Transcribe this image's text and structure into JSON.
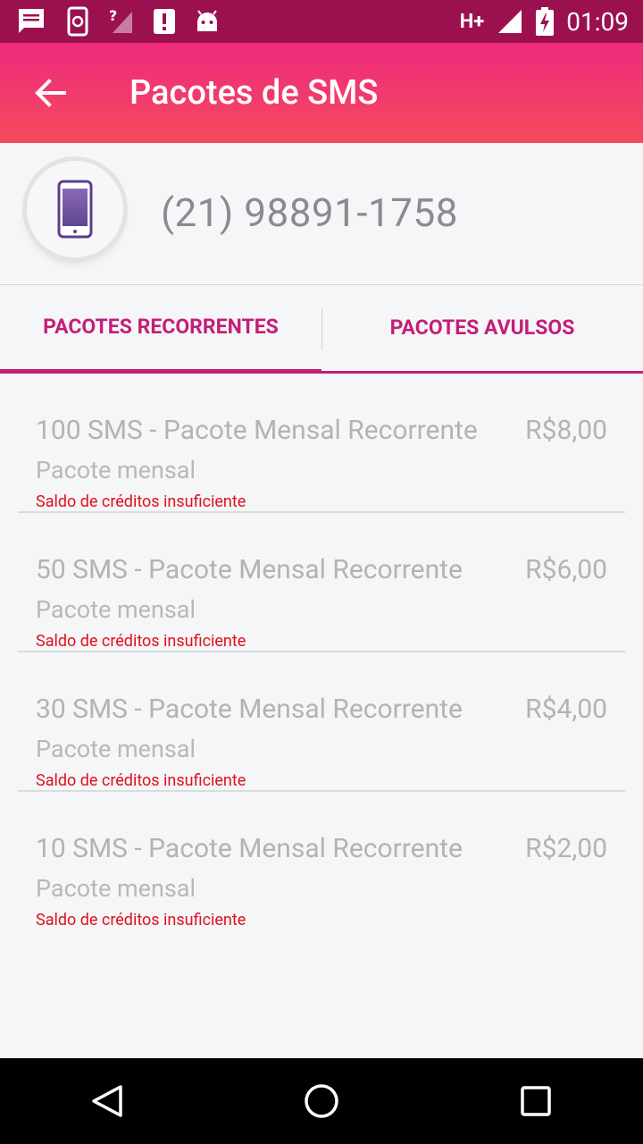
{
  "status_bar": {
    "network_type": "H+",
    "time": "01:09",
    "icons": [
      "message-icon",
      "phone-sync-icon",
      "no-signal-icon",
      "alert-icon",
      "android-icon",
      "signal-icon",
      "battery-charging-icon"
    ]
  },
  "app_bar": {
    "title": "Pacotes de SMS",
    "back_icon": "arrow-left-icon"
  },
  "phone_header": {
    "number": "(21) 98891-1758",
    "avatar_icon": "smartphone-icon"
  },
  "tabs": [
    {
      "label": "PACOTES RECORRENTES",
      "active": true
    },
    {
      "label": "PACOTES AVULSOS",
      "active": false
    }
  ],
  "packages": [
    {
      "title": "100 SMS - Pacote Mensal Recorrente",
      "price": "R$8,00",
      "subtitle": "Pacote mensal",
      "warning": "Saldo de créditos insuficiente"
    },
    {
      "title": "50 SMS - Pacote Mensal Recorrente",
      "price": "R$6,00",
      "subtitle": "Pacote mensal",
      "warning": "Saldo de créditos insuficiente"
    },
    {
      "title": "30 SMS - Pacote Mensal Recorrente",
      "price": "R$4,00",
      "subtitle": "Pacote mensal",
      "warning": "Saldo de créditos insuficiente"
    },
    {
      "title": "10 SMS - Pacote Mensal Recorrente",
      "price": "R$2,00",
      "subtitle": "Pacote mensal",
      "warning": "Saldo de créditos insuficiente"
    }
  ],
  "nav_bar": {
    "icons": [
      "back-triangle-icon",
      "home-circle-icon",
      "recents-square-icon"
    ]
  },
  "colors": {
    "status_bar": "#9b1150",
    "app_bar_top": "#ef2a7c",
    "app_bar_bottom": "#f34b5c",
    "accent": "#c41e78",
    "warning": "#e0101c"
  }
}
